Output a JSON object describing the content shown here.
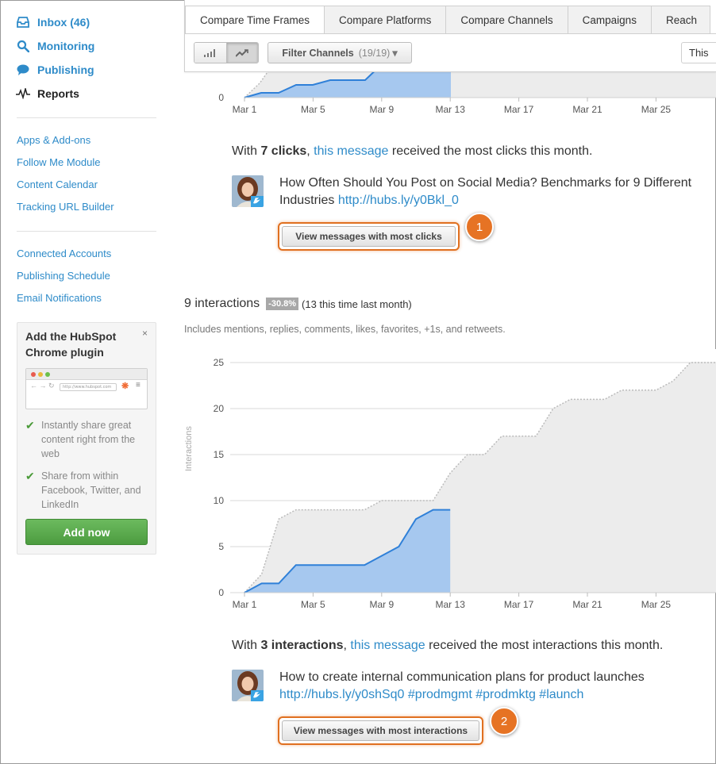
{
  "sidebar": {
    "nav": [
      {
        "label": "Inbox (46)",
        "icon": "inbox-icon",
        "active": false
      },
      {
        "label": "Monitoring",
        "icon": "search-icon",
        "active": false
      },
      {
        "label": "Publishing",
        "icon": "speech-bubble-icon",
        "active": false
      },
      {
        "label": "Reports",
        "icon": "pulse-icon",
        "active": true
      }
    ],
    "links_group1": [
      "Apps & Add-ons",
      "Follow Me Module",
      "Content Calendar",
      "Tracking URL Builder"
    ],
    "links_group2": [
      "Connected Accounts",
      "Publishing Schedule",
      "Email Notifications"
    ],
    "promo": {
      "title": "Add the HubSpot Chrome plugin",
      "close": "×",
      "browser_url": "http://www.hubspot.com",
      "features": [
        "Instantly share great content right from the web",
        "Share from within Facebook, Twitter, and LinkedIn"
      ],
      "button": "Add now"
    }
  },
  "toolbar": {
    "tabs": [
      "Compare Time Frames",
      "Compare Platforms",
      "Compare Channels",
      "Campaigns",
      "Reach"
    ],
    "active_tab": 0,
    "filter_label": "Filter Channels",
    "filter_count": "(19/19)",
    "filter_caret": "▾",
    "period_button": "This"
  },
  "clicks_section": {
    "summary_pre": "With ",
    "summary_bold": "7 clicks",
    "summary_mid": ", ",
    "summary_link": "this message",
    "summary_post": " received the most clicks this month.",
    "message_text": "How Often Should You Post on Social Media? Benchmarks for 9 Different Industries ",
    "message_link": "http://hubs.ly/y0Bkl_0",
    "button": "View messages with most clicks",
    "callout": "1"
  },
  "interactions_section": {
    "title": "9 interactions",
    "change_badge": "-30.8%",
    "comparison": "(13 this time last month)",
    "note": "Includes mentions, replies, comments, likes, favorites, +1s, and retweets.",
    "summary_pre": "With ",
    "summary_bold": "3 interactions",
    "summary_mid": ", ",
    "summary_link": "this message",
    "summary_post": " received the most interactions this month.",
    "message_text": "How to create internal communication plans for product launches ",
    "message_link": "http://hubs.ly/y0shSq0",
    "hashtags": "#prodmgmt #prodmktg #launch",
    "button": "View messages with most interactions",
    "callout": "2"
  },
  "colors": {
    "link": "#2e8bc9",
    "current_fill": "#a6c8ef",
    "current_line": "#2f80d8",
    "previous_fill": "#ececec",
    "previous_line": "#bbbbbb",
    "highlight": "#e07020",
    "success": "#4a9a38"
  },
  "chart_data": [
    {
      "type": "area",
      "title": "",
      "x_ticks": [
        "Mar 1",
        "Mar 5",
        "Mar 9",
        "Mar 13",
        "Mar 17",
        "Mar 21",
        "Mar 25"
      ],
      "y_ticks_visible": [
        "0"
      ],
      "series": []
    },
    {
      "type": "area",
      "title": "",
      "ylabel": "Interactions",
      "ylim": [
        0,
        25
      ],
      "y_ticks": [
        0,
        5,
        10,
        15,
        20,
        25
      ],
      "x_ticks": [
        "Mar 1",
        "Mar 5",
        "Mar 9",
        "Mar 13",
        "Mar 17",
        "Mar 21",
        "Mar 25"
      ],
      "x_days": [
        1,
        2,
        3,
        4,
        5,
        6,
        7,
        8,
        9,
        10,
        11,
        12,
        13,
        14,
        15,
        16,
        17,
        18,
        19,
        20,
        21,
        22,
        23,
        24,
        25,
        26,
        27,
        28
      ],
      "series": [
        {
          "values": [
            0,
            1,
            1,
            3,
            3,
            3,
            3,
            3,
            4,
            5,
            8,
            9,
            9
          ]
        },
        {
          "values": [
            0,
            2,
            8,
            9,
            9,
            9,
            9,
            9,
            10,
            10,
            10,
            10,
            13,
            15,
            15,
            17,
            17,
            17,
            20,
            21,
            21,
            21,
            22,
            22,
            22,
            23,
            25,
            25
          ]
        }
      ]
    }
  ]
}
